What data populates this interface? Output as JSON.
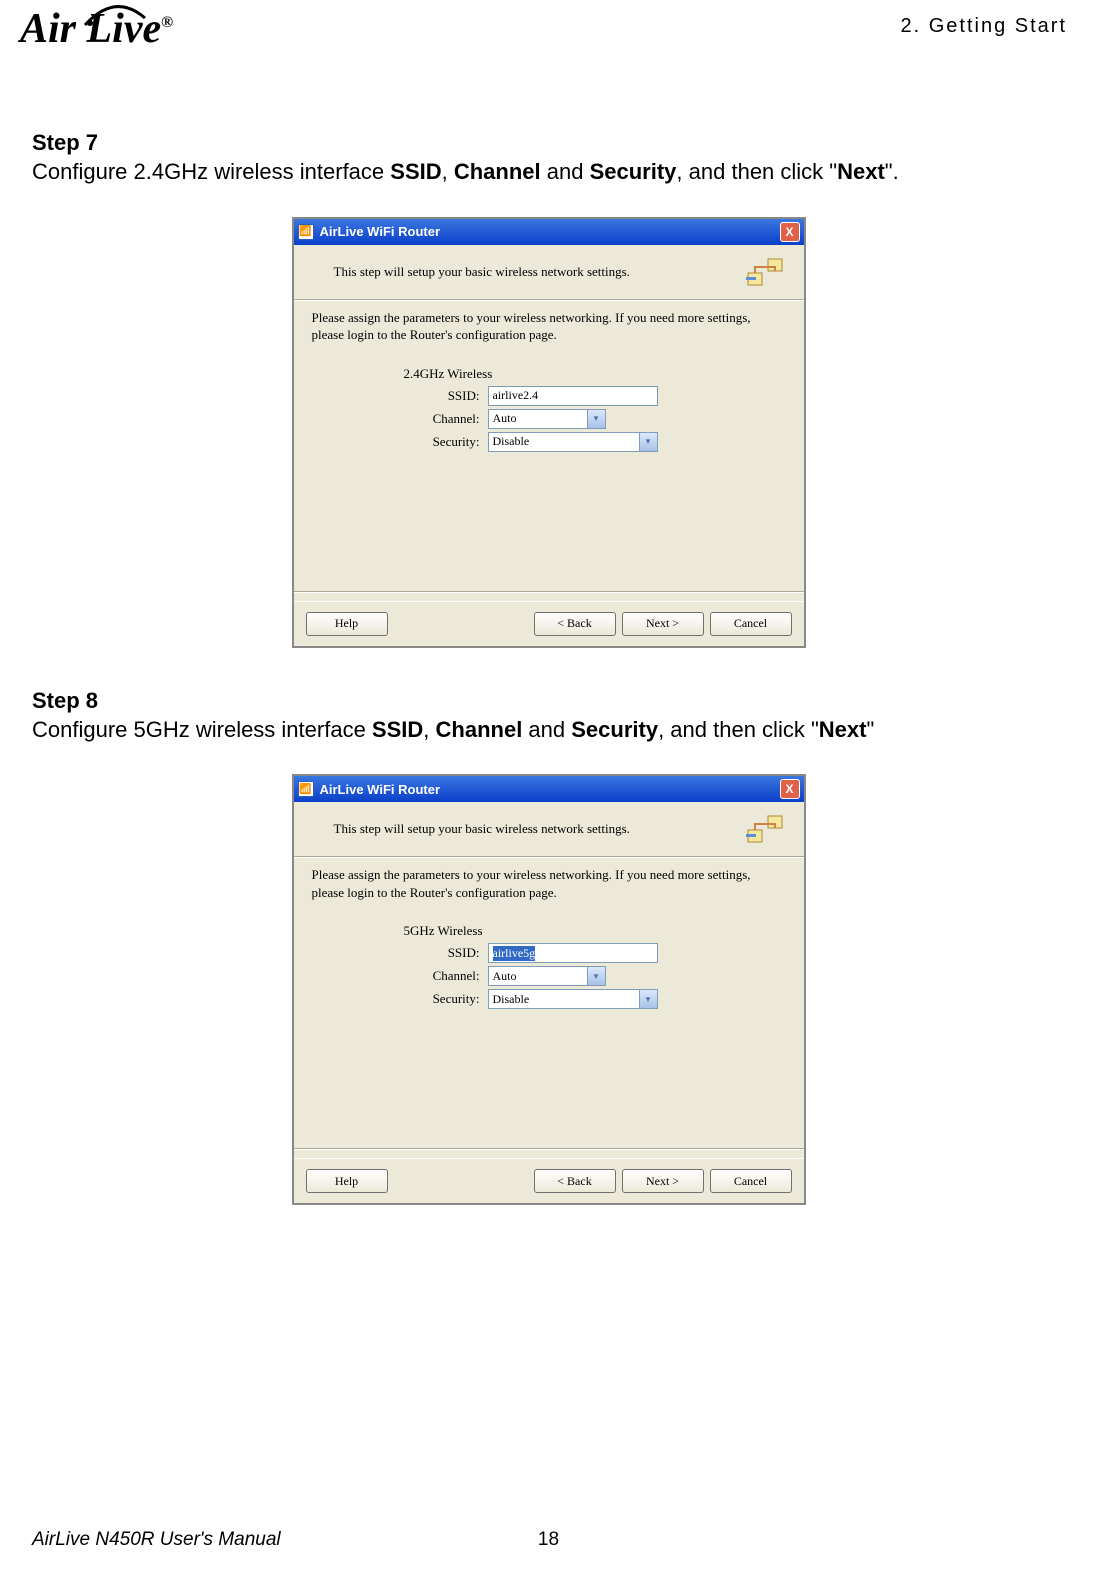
{
  "header": {
    "logo_text": "Air Live",
    "logo_reg": "®",
    "chapter": "2.  Getting  Start"
  },
  "step7": {
    "title": "Step 7",
    "text_pre": "Configure 2.4GHz wireless interface ",
    "b1": "SSID",
    "sep1": ", ",
    "b2": "Channel",
    "sep2": " and ",
    "b3": "Security",
    "sep3": ", and then click \"",
    "b4": "Next",
    "text_post": "\"."
  },
  "step8": {
    "title": "Step 8",
    "text_pre": "Configure 5GHz wireless interface ",
    "b1": "SSID",
    "sep1": ", ",
    "b2": "Channel",
    "sep2": " and ",
    "b3": "Security",
    "sep3": ", and then click \"",
    "b4": "Next",
    "text_post": "\""
  },
  "dialog1": {
    "title": "AirLive WiFi Router",
    "header_text": "This step will setup your basic wireless network settings.",
    "instructions": "Please assign the parameters to your wireless networking. If you need more settings, please login to the Router's configuration page.",
    "section_label": "2.4GHz Wireless",
    "ssid_label": "SSID:",
    "ssid_value": "airlive2.4",
    "channel_label": "Channel:",
    "channel_value": "Auto",
    "security_label": "Security:",
    "security_value": "Disable",
    "help_btn": "Help",
    "back_btn": "< Back",
    "next_btn": "Next >",
    "cancel_btn": "Cancel"
  },
  "dialog2": {
    "title": "AirLive WiFi Router",
    "header_text": "This step will setup your basic wireless network settings.",
    "instructions": "Please assign the parameters to your wireless networking. If you need more settings, please login to the Router's configuration page.",
    "section_label": "5GHz Wireless",
    "ssid_label": "SSID:",
    "ssid_value": "airlive5g",
    "channel_label": "Channel:",
    "channel_value": "Auto",
    "security_label": "Security:",
    "security_value": "Disable",
    "help_btn": "Help",
    "back_btn": "< Back",
    "next_btn": "Next >",
    "cancel_btn": "Cancel"
  },
  "footer": {
    "manual": "AirLive N450R User's Manual",
    "page": "18"
  }
}
